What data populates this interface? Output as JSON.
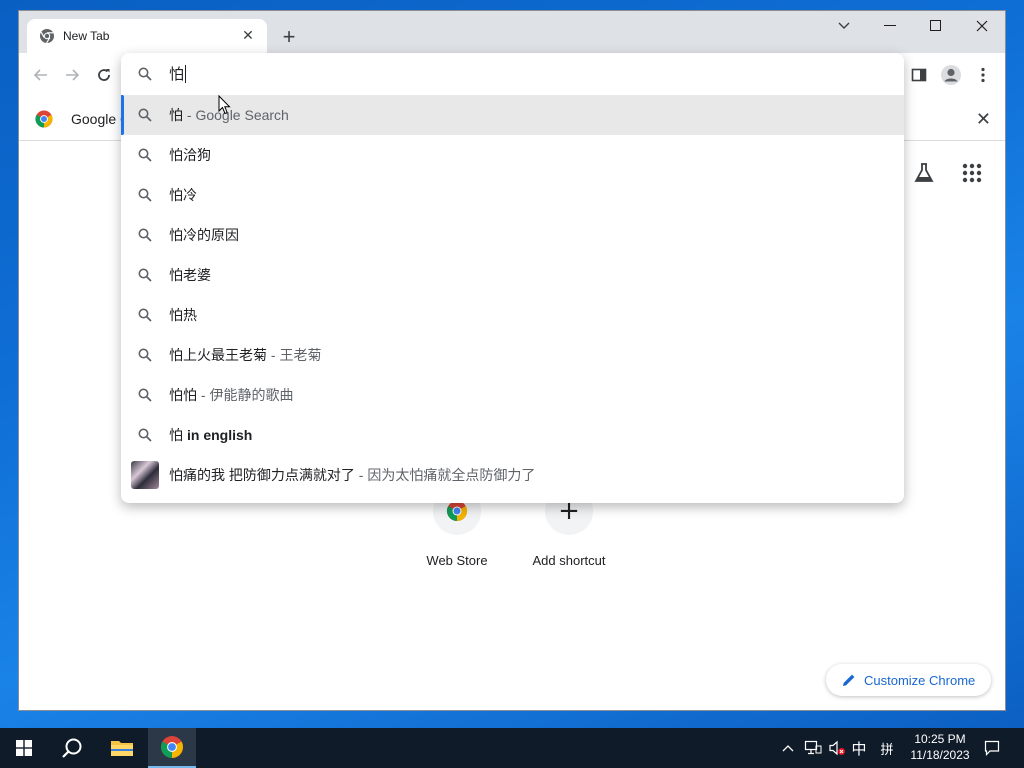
{
  "tab": {
    "title": "New Tab",
    "favicon": "chrome-icon",
    "close": "✕"
  },
  "tabstrip": {
    "new_tab": "+",
    "search_tabs": "chevron-down-icon"
  },
  "window_controls": {
    "minimize": "—",
    "maximize": "☐",
    "close": "✕"
  },
  "infobar": {
    "text": "Google C"
  },
  "omnibox": {
    "value": "怕",
    "suggestions": [
      {
        "main": "怕",
        "sub": " - Google Search",
        "icon": "search-icon",
        "selected": true
      },
      {
        "main": "怕洽狗",
        "sub": "",
        "icon": "search-icon"
      },
      {
        "main": "怕冷",
        "sub": "",
        "icon": "search-icon"
      },
      {
        "main": "怕冷的原因",
        "sub": "",
        "icon": "search-icon"
      },
      {
        "main": "怕老婆",
        "sub": "",
        "icon": "search-icon"
      },
      {
        "main": "怕热",
        "sub": "",
        "icon": "search-icon"
      },
      {
        "main": "怕上火最王老菊",
        "sub": " - 王老菊",
        "icon": "search-icon"
      },
      {
        "main": "怕怕",
        "sub": " - 伊能静的歌曲",
        "icon": "search-icon"
      },
      {
        "main": "怕",
        "bold": "in english",
        "icon": "search-icon"
      },
      {
        "main": "怕痛的我 把防御力点满就对了",
        "sub": " - 因为太怕痛就全点防御力了",
        "icon": "thumbnail"
      }
    ]
  },
  "shortcuts": [
    {
      "label": "Web Store",
      "icon": "webstore-icon"
    },
    {
      "label": "Add shortcut",
      "icon": "+"
    }
  ],
  "customize": {
    "label": "Customize Chrome"
  },
  "taskbar": {
    "ime_mode": "中",
    "ime_layout": "拼",
    "time": "10:25 PM",
    "date": "11/18/2023"
  }
}
